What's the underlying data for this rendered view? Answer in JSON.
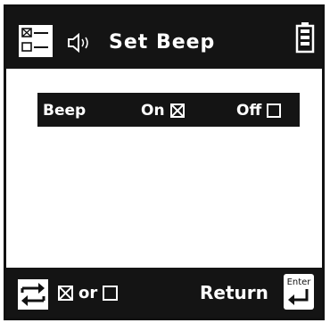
{
  "header": {
    "title": "Set Beep",
    "icons": [
      "menu-icon",
      "speaker-icon",
      "battery-icon"
    ]
  },
  "setting": {
    "label": "Beep",
    "on_label": "On",
    "off_label": "Off",
    "selected": "On"
  },
  "footer": {
    "or_label": "or",
    "return_label": "Return",
    "enter_label": "Enter",
    "icons": [
      "swap-arrows-icon",
      "checked-box-icon",
      "unchecked-box-icon",
      "enter-key-icon"
    ]
  },
  "colors": {
    "background": "#ffffff",
    "bar": "#141414",
    "text": "#ffffff"
  }
}
